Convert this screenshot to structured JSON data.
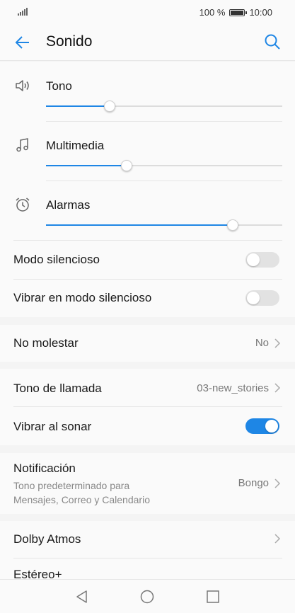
{
  "status_bar": {
    "battery": "100 %",
    "time": "10:00"
  },
  "app_bar": {
    "title": "Sonido"
  },
  "volume": [
    {
      "label": "Tono",
      "icon": "speaker-icon",
      "level": 0.27
    },
    {
      "label": "Multimedia",
      "icon": "music-note-icon",
      "level": 0.34
    },
    {
      "label": "Alarmas",
      "icon": "alarm-clock-icon",
      "level": 0.79
    }
  ],
  "silent_mode": {
    "label": "Modo silencioso",
    "enabled": false
  },
  "vibrate_silent": {
    "label": "Vibrar en modo silencioso",
    "enabled": false
  },
  "do_not_disturb": {
    "label": "No molestar",
    "value": "No"
  },
  "ringtone": {
    "label": "Tono de llamada",
    "value": "03-new_stories"
  },
  "vibrate_ring": {
    "label": "Vibrar al sonar",
    "enabled": true
  },
  "notification": {
    "label": "Notificación",
    "subtitle": "Tono predeterminado para Mensajes, Correo y Calendario",
    "value": "Bongo"
  },
  "dolby": {
    "label": "Dolby Atmos"
  },
  "stereo": {
    "label": "Estéreo+"
  },
  "colors": {
    "accent": "#1e86e5",
    "background": "#f4f4f4",
    "card": "#fafafa"
  }
}
